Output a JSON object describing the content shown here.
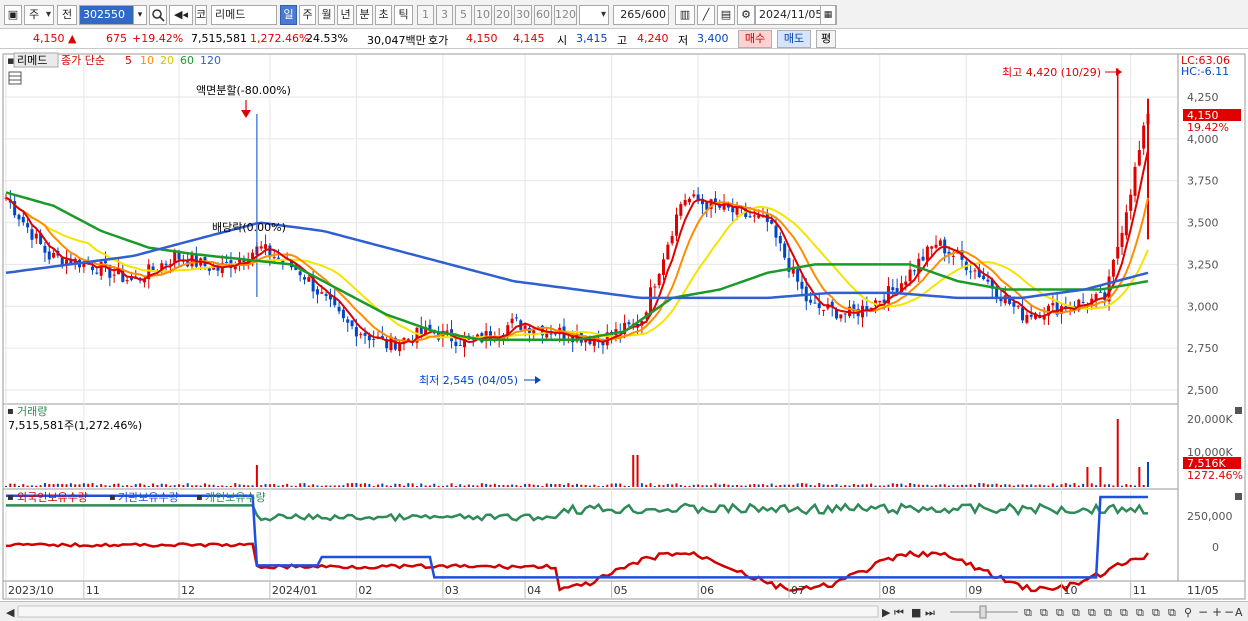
{
  "toolbar": {
    "period_label": "주",
    "type_label": "전",
    "code_value": "302550",
    "name_prefix": "코",
    "name_value": "리메드",
    "period_buttons": [
      "일",
      "주",
      "월",
      "년",
      "분",
      "초",
      "틱"
    ],
    "interval_buttons": [
      "1",
      "3",
      "5",
      "10",
      "20",
      "30",
      "60",
      "120"
    ],
    "count_value": "265",
    "count_total": "/600",
    "date_value": "2024/11/05"
  },
  "quote": {
    "price": "4,150",
    "change_arrow": "▲",
    "change": "675",
    "change_pct": "+19.42%",
    "volume": "7,515,581",
    "volume_pct": "1,272.46%",
    "turnover_pct": "24.53%",
    "amount": "30,047백만",
    "hoga_label": "호가",
    "ask": "4,150",
    "bid": "4,145",
    "open_label": "시",
    "open": "3,415",
    "high_label": "고",
    "high": "4,240",
    "low_label": "저",
    "low": "3,400",
    "buy_label": "매수",
    "sell_label": "매도",
    "eval_label": "평"
  },
  "legend": {
    "name": "리메드",
    "price_label": "종가 단순",
    "ma_labels": [
      "5",
      "10",
      "20",
      "60",
      "120"
    ],
    "volume_title": "거래량",
    "volume_value": "7,515,581주(1,272.46%)",
    "holdings_foreign": "외국인보유수량",
    "holdings_inst": "기관보유수량",
    "holdings_indiv": "개인보유수량",
    "lc": "LC:63.06",
    "hc": "HC:-6.11"
  },
  "annotations": {
    "split": "액면분할(-80.00%)",
    "dividend": "배당락(0.00%)",
    "high": "최고 4,420 (10/29)",
    "low": "최저 2,545 (04/05)"
  },
  "price_axis": {
    "ticks": [
      "4,250",
      "4,000",
      "3,750",
      "3,500",
      "3,250",
      "3,000",
      "2,750",
      "2,500"
    ],
    "current": "4,150",
    "current_pct": "19.42%"
  },
  "volume_axis": {
    "ticks": [
      "20,000K",
      "10,000K"
    ],
    "current": "7,516K",
    "current_pct": "1272.46%"
  },
  "holdings_axis": {
    "ticks": [
      "250,000",
      "0"
    ]
  },
  "x_axis": [
    "2023/10",
    "11",
    "12",
    "2024/01",
    "02",
    "03",
    "04",
    "05",
    "06",
    "07",
    "08",
    "09",
    "10",
    "11",
    "11/05"
  ],
  "colors": {
    "up": "#e00000",
    "down": "#0047c8",
    "ma5": "#e00000",
    "ma10": "#ff8c00",
    "ma20": "#f5e400",
    "ma60": "#1a9a2a",
    "ma120": "#2f5fd0",
    "foreign": "#d00000",
    "institution": "#1f4fe0",
    "individual": "#2e8b57"
  },
  "chart_data": {
    "type": "line",
    "title": "리메드",
    "y_range": [
      2500,
      4420
    ],
    "x_range": [
      "2023/10",
      "2024/11/05"
    ],
    "series": [
      {
        "name": "종가 5",
        "values": [
          3650,
          3300,
          3250,
          3150,
          3300,
          3220,
          3350,
          3200,
          2900,
          2770,
          2850,
          2780,
          2900,
          2850,
          2800,
          2900,
          3650,
          3580,
          3500,
          3000,
          2950,
          3100,
          3380,
          3200,
          2950,
          3000,
          3050,
          4150
        ]
      },
      {
        "name": "종가 60",
        "values": [
          3680,
          3600,
          3450,
          3350,
          3310,
          3280,
          3250,
          3100,
          2950,
          2850,
          2800,
          2800,
          2800,
          2850,
          3050,
          3100,
          3200,
          3250,
          3250,
          3250,
          3150,
          3100,
          3100,
          3100,
          3150
        ]
      },
      {
        "name": "종가 120",
        "values": [
          3200,
          3250,
          3300,
          3400,
          3500,
          3450,
          3350,
          3250,
          3150,
          3100,
          3050,
          3050,
          3050,
          3080,
          3080,
          3050,
          3050,
          3100,
          3200
        ]
      }
    ],
    "high": {
      "value": 4420,
      "date": "10/29"
    },
    "low": {
      "value": 2545,
      "date": "04/05"
    }
  }
}
